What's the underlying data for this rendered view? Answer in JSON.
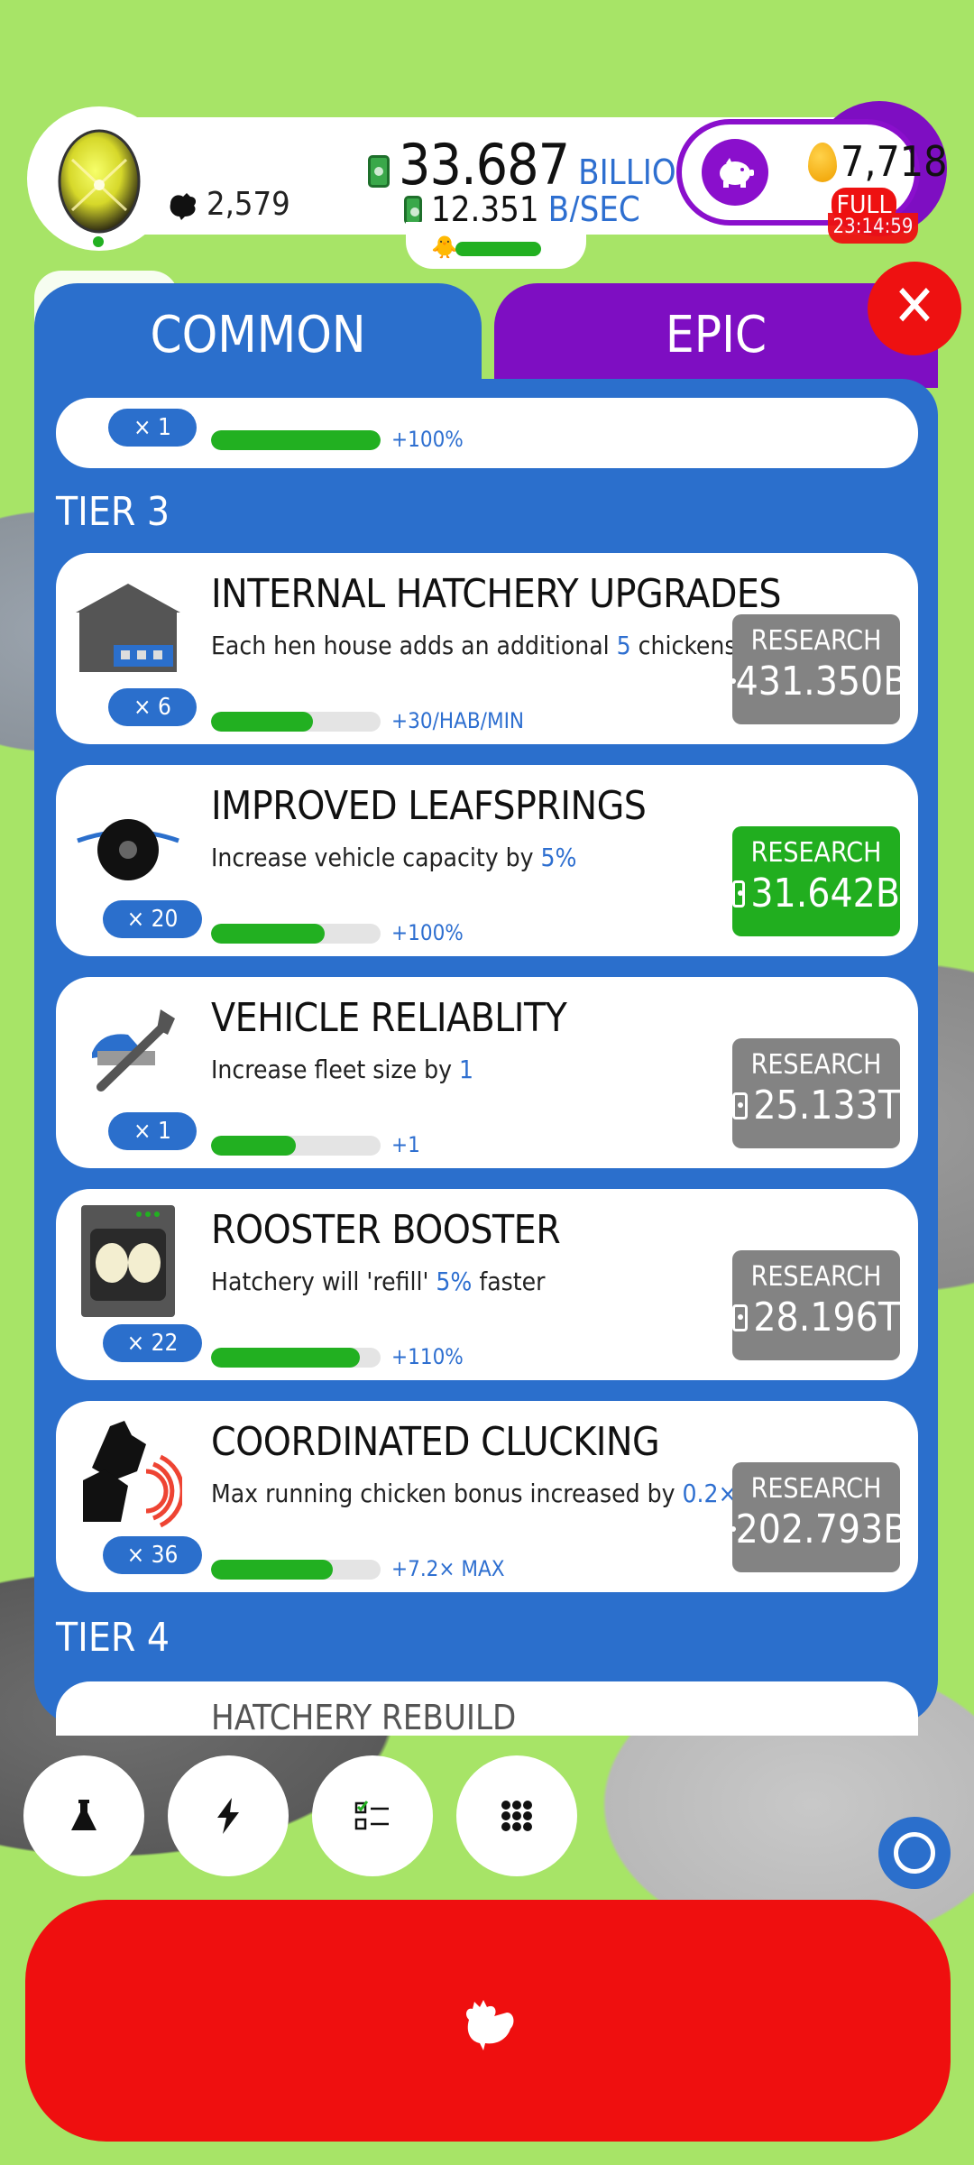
{
  "top": {
    "chicken_count": "2,579",
    "money_value": "33.687",
    "money_unit": "BILLION",
    "rate_value": "12.351",
    "rate_unit": "B/SEC",
    "golden_eggs": "7,718",
    "full_label": "FULL",
    "timer": "23:14:59"
  },
  "tabs": {
    "common": "COMMON",
    "epic": "EPIC",
    "close": "✕"
  },
  "partial_card": {
    "multiplier": "× 1",
    "progress": 1.0,
    "bonus": "+100%"
  },
  "tier3_label": "TIER 3",
  "tier4_label": "TIER 4",
  "research": [
    {
      "title": "INTERNAL HATCHERY UPGRADES",
      "desc_pre": "Each hen house adds an additional ",
      "desc_hl": "5",
      "desc_post": " chickens/min",
      "multiplier": "× 6",
      "progress": 0.6,
      "bonus": "+30/HAB/MIN",
      "btn_label": "RESEARCH",
      "price": "431.350B",
      "affordable": false,
      "icon": "hen-house-icon"
    },
    {
      "title": "IMPROVED LEAFSPRINGS",
      "desc_pre": "Increase vehicle capacity by ",
      "desc_hl": "5%",
      "desc_post": "",
      "multiplier": "× 20",
      "progress": 0.67,
      "bonus": "+100%",
      "btn_label": "RESEARCH",
      "price": "31.642B",
      "affordable": true,
      "icon": "leafspring-wheel-icon"
    },
    {
      "title": "VEHICLE RELIABLITY",
      "desc_pre": "Increase fleet size by ",
      "desc_hl": "1",
      "desc_post": "",
      "multiplier": "× 1",
      "progress": 0.5,
      "bonus": "+1",
      "btn_label": "RESEARCH",
      "price": "25.133T",
      "affordable": false,
      "icon": "wrench-truck-icon"
    },
    {
      "title": "ROOSTER BOOSTER",
      "desc_pre": "Hatchery will 'refill' ",
      "desc_hl": "5%",
      "desc_post": " faster",
      "multiplier": "× 22",
      "progress": 0.88,
      "bonus": "+110%",
      "btn_label": "RESEARCH",
      "price": "28.196T",
      "affordable": false,
      "icon": "incubator-icon"
    },
    {
      "title": "COORDINATED CLUCKING",
      "desc_pre": "Max running chicken bonus increased by ",
      "desc_hl": "0.2×",
      "desc_post": "",
      "multiplier": "× 36",
      "progress": 0.72,
      "bonus": "+7.2× MAX",
      "btn_label": "RESEARCH",
      "price": "202.793B",
      "affordable": false,
      "icon": "clucking-chickens-icon"
    }
  ],
  "peek_title": "HATCHERY REBUILD",
  "colors": {
    "panel_blue": "#2b6fcc",
    "epic_purple": "#7e0ec2",
    "research_green": "#21ae1f",
    "research_grey": "#838383",
    "hatch_red": "#ef0f0f",
    "background_green": "#a7e467"
  }
}
